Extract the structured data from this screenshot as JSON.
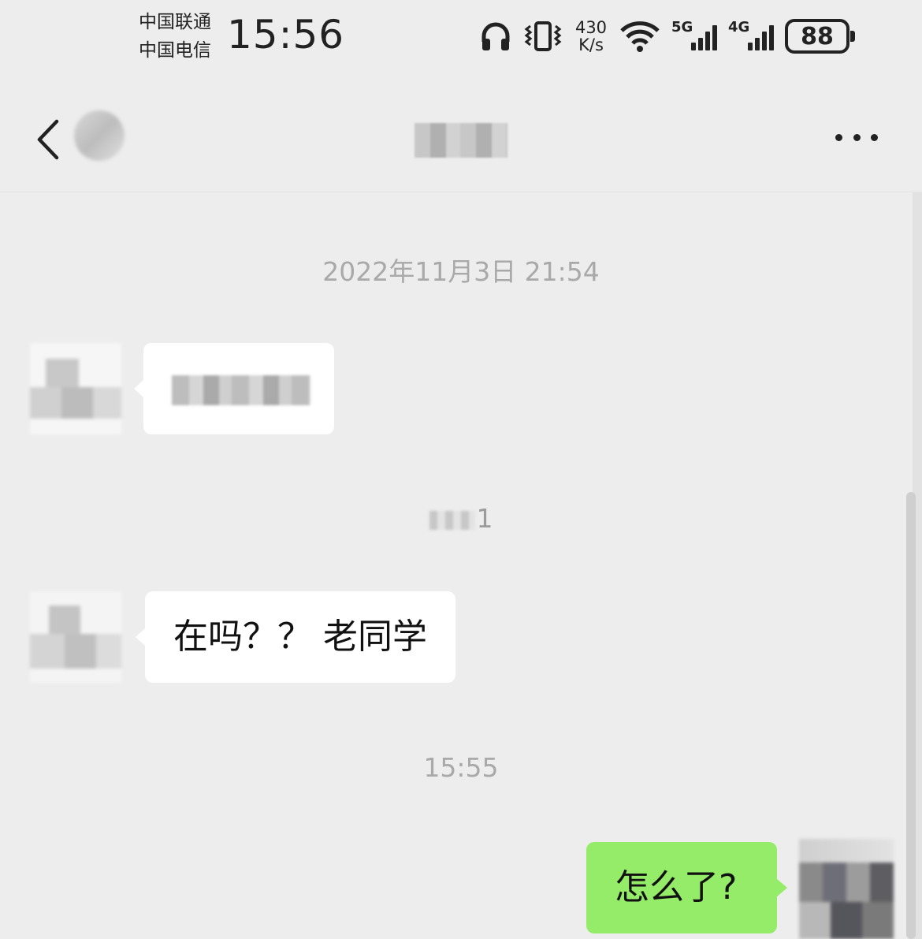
{
  "status_bar": {
    "carrier_1": "中国联通",
    "carrier_2": "中国电信",
    "time": "15:56",
    "net_speed_value": "430",
    "net_speed_unit": "K/s",
    "signal_1": "5G",
    "signal_2": "4G",
    "battery": "88",
    "icons": [
      "headphones-icon",
      "vibrate-icon",
      "wifi-icon",
      "signal-icon",
      "battery-icon"
    ]
  },
  "nav": {
    "back_icon": "chevron-left-icon",
    "more_icon": "more-dots-icon"
  },
  "chat": {
    "timestamp_1": "2022年11月3日 21:54",
    "timestamp_2_visible_suffix": "1",
    "timestamp_3": "15:55",
    "message_2": "在吗？？ 老同学",
    "message_3": "怎么了?"
  },
  "colors": {
    "background": "#ededed",
    "incoming_bubble": "#ffffff",
    "outgoing_bubble": "#95ec69",
    "timestamp": "#a9a9a9"
  }
}
